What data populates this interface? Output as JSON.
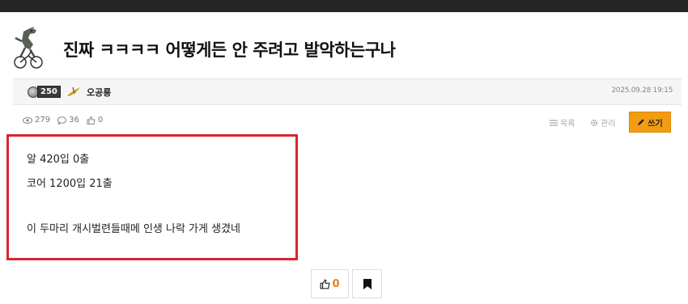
{
  "post": {
    "title": "진짜 ㅋㅋㅋㅋ 어떻게든 안 주려고 발악하는구나",
    "author": "오공룡",
    "level": "250",
    "date": "2025.09.28 19:15",
    "views": "279",
    "comments": "36",
    "likes": "0",
    "content": {
      "line1": "알 420입 0출",
      "line2": "코어 1200입 21출",
      "line3": "이 두마리 개시벌련들때메 인생 나락 가게 생겼네"
    }
  },
  "toolbar": {
    "list_label": "목록",
    "admin_label": "관리",
    "write_label": "쓰기"
  },
  "actions": {
    "like_count": "0"
  },
  "colors": {
    "accent": "#f39c12",
    "highlight_border": "#d7262e",
    "like": "#e67e22"
  },
  "icons": [
    "mascot-avatar",
    "level-coin-icon",
    "class-icon",
    "eye-icon",
    "comment-icon",
    "thumbs-up-icon",
    "list-icon",
    "gear-icon",
    "pencil-icon",
    "bookmark-icon"
  ]
}
